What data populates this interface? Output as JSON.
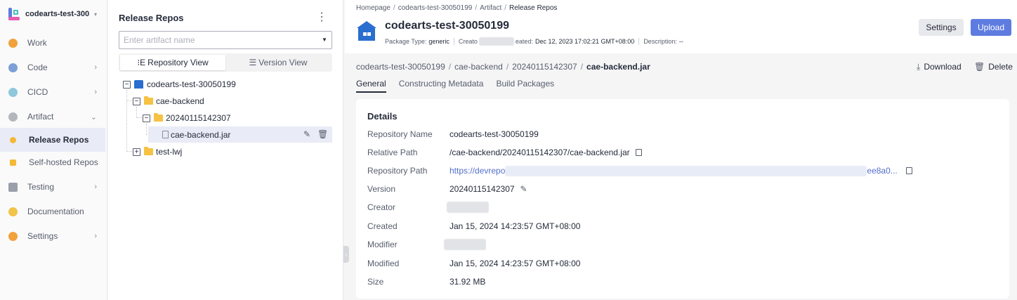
{
  "project": {
    "name": "codearts-test-300...",
    "caret": "▾"
  },
  "nav": {
    "items": [
      {
        "label": "Work",
        "icon": "work-icon",
        "color": "#f0a23c",
        "chevron": ""
      },
      {
        "label": "Code",
        "icon": "code-icon",
        "color": "#7c9fd6",
        "chevron": "›"
      },
      {
        "label": "CICD",
        "icon": "cicd-icon",
        "color": "#8fc7dc",
        "chevron": "›"
      },
      {
        "label": "Artifact",
        "icon": "artifact-icon",
        "color": "#b3b6bd",
        "chevron": "⌄"
      },
      {
        "label": "Release Repos",
        "icon": "release-repos-icon",
        "color": "#f5b938",
        "chevron": ""
      },
      {
        "label": "Self-hosted Repos",
        "icon": "self-hosted-repos-icon",
        "color": "#f5b938",
        "chevron": ""
      },
      {
        "label": "Testing",
        "icon": "testing-icon",
        "color": "#9aa0aa",
        "chevron": "›"
      },
      {
        "label": "Documentation",
        "icon": "documentation-icon",
        "color": "#f0c34a",
        "chevron": ""
      },
      {
        "label": "Settings",
        "icon": "settings-icon",
        "color": "#f0a23c",
        "chevron": "›"
      }
    ]
  },
  "tree_panel": {
    "title": "Release Repos",
    "more": "⋮",
    "search_placeholder": "Enter artifact name",
    "repository_view": "Repository View",
    "version_view": "Version View",
    "nodes": {
      "root": "codearts-test-30050199",
      "folder1": "cae-backend",
      "folder2": "20240115142307",
      "file": "cae-backend.jar",
      "folder3": "test-lwj"
    }
  },
  "header": {
    "breadcrumb": [
      "Homepage",
      "codearts-test-30050199",
      "Artifact",
      "Release Repos"
    ],
    "title": "codearts-test-30050199",
    "meta": {
      "type_label": "Package Type:",
      "type_value": "generic",
      "creator_label": "Creato",
      "created_label": "eated:",
      "created_value": "Dec 12, 2023 17:02:21 GMT+08:00",
      "desc_label": "Description:",
      "desc_value": "--"
    },
    "settings": "Settings",
    "upload": "Upload"
  },
  "path": {
    "segments": [
      "codearts-test-30050199",
      "cae-backend",
      "20240115142307"
    ],
    "current": "cae-backend.jar",
    "separator": "/"
  },
  "actions": {
    "download": "Download",
    "delete": "Delete"
  },
  "tabs": [
    "General",
    "Constructing Metadata",
    "Build Packages"
  ],
  "details": {
    "title": "Details",
    "repository_name": {
      "label": "Repository Name",
      "value": "codearts-test-30050199"
    },
    "relative_path": {
      "label": "Relative Path",
      "value": "/cae-backend/20240115142307/cae-backend.jar"
    },
    "repository_path": {
      "label": "Repository Path",
      "value": "https://devrepo",
      "tail": "ee8a0..."
    },
    "version": {
      "label": "Version",
      "value": "20240115142307"
    },
    "creator": {
      "label": "Creator"
    },
    "created": {
      "label": "Created",
      "value": "Jan 15, 2024 14:23:57 GMT+08:00"
    },
    "modifier": {
      "label": "Modifier"
    },
    "modified": {
      "label": "Modified",
      "value": "Jan 15, 2024 14:23:57 GMT+08:00"
    },
    "size": {
      "label": "Size",
      "value": "31.92 MB"
    }
  }
}
